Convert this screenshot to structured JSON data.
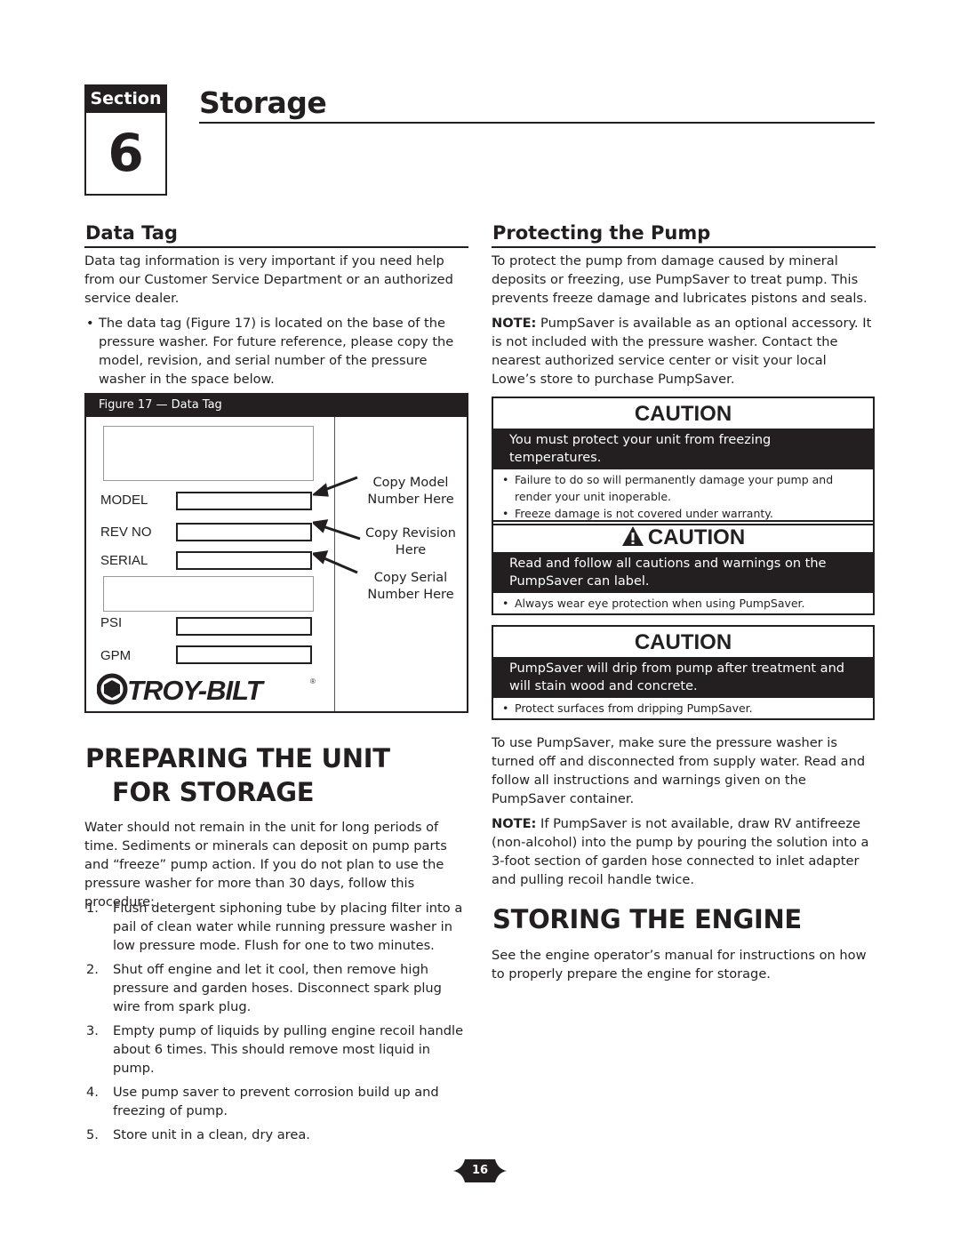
{
  "header": {
    "section_label": "Section",
    "section_number": "6",
    "title": "Storage"
  },
  "data_tag": {
    "heading": "Data Tag",
    "intro": "Data tag information is very important if you need help from our Customer Service Department or an authorized service dealer.",
    "bullet": "The data tag (Figure 17) is located on the base of the pressure washer. For future reference, please copy the model, revision, and serial number of the pressure washer in the space below.",
    "figure": {
      "caption": "Figure 17 — Data Tag",
      "fields": [
        "MODEL",
        "REV NO",
        "SERIAL",
        "PSI",
        "GPM"
      ],
      "notes": [
        "Copy Model Number Here",
        "Copy Revision Here",
        "Copy Serial Number Here"
      ],
      "brand": "TROY-BILT",
      "brand_mark": "®"
    }
  },
  "protecting_pump": {
    "heading": "Protecting the Pump",
    "intro": "To protect the pump from damage caused by mineral deposits or freezing, use PumpSaver to treat pump. This prevents freeze damage and lubricates pistons and seals.",
    "note_label": "NOTE:",
    "note_text": " PumpSaver is available as an optional accessory. It is not included with the pressure washer. Contact the nearest authorized service center or visit your local Lowe’s store to purchase PumpSaver.",
    "cautions": [
      {
        "title": "CAUTION",
        "icon": "warning-triangle-icon-none",
        "band": "You must protect your unit from freezing temperatures.",
        "bullets": [
          "Failure to do so will permanently damage your pump and render your unit inoperable.",
          "Freeze damage is not covered under warranty."
        ]
      },
      {
        "title": "CAUTION",
        "icon": "warning-triangle-icon",
        "band": "Read and follow all cautions and warnings on the PumpSaver can label.",
        "bullets": [
          "Always wear eye protection when using PumpSaver."
        ]
      },
      {
        "title": "CAUTION",
        "icon": "none",
        "band": "PumpSaver will drip from pump after treatment and will stain wood and concrete.",
        "bullets": [
          "Protect surfaces from dripping PumpSaver."
        ]
      }
    ],
    "usage": "To use PumpSaver, make sure the pressure washer is turned off and disconnected from supply water. Read and follow all instructions and warnings given on the PumpSaver container.",
    "note2_label": "NOTE:",
    "note2_text": " If PumpSaver is not available, draw RV antifreeze (non-alcohol) into the pump by pouring the solution into a 3-foot section of garden hose connected to inlet adapter and pulling recoil handle twice."
  },
  "preparing": {
    "heading_line1": "PREPARING THE UNIT",
    "heading_line2": "FOR STORAGE",
    "intro": "Water should not remain in the unit for long periods of time. Sediments or minerals can deposit on pump parts and “freeze” pump action. If you do not plan to use the pressure washer for more than 30 days, follow this procedure:",
    "steps": [
      {
        "n": "1.",
        "text": "Flush detergent siphoning tube by placing filter into a pail of clean water while running pressure washer in low pressure mode. Flush for one to two minutes."
      },
      {
        "n": "2.",
        "text": "Shut off engine and let it cool, then remove high pressure and garden hoses. Disconnect spark plug wire from spark plug."
      },
      {
        "n": "3.",
        "text": "Empty pump of liquids by pulling engine recoil handle about 6 times. This should remove most liquid in pump."
      },
      {
        "n": "4.",
        "text": "Use pump saver to prevent corrosion build up and freezing of pump."
      },
      {
        "n": "5.",
        "text": "Store unit in a clean, dry area."
      }
    ]
  },
  "engine": {
    "heading": "STORING THE ENGINE",
    "text": "See the engine operator’s manual for instructions on how to properly prepare the engine for storage."
  },
  "footer": {
    "page_number": "16"
  }
}
